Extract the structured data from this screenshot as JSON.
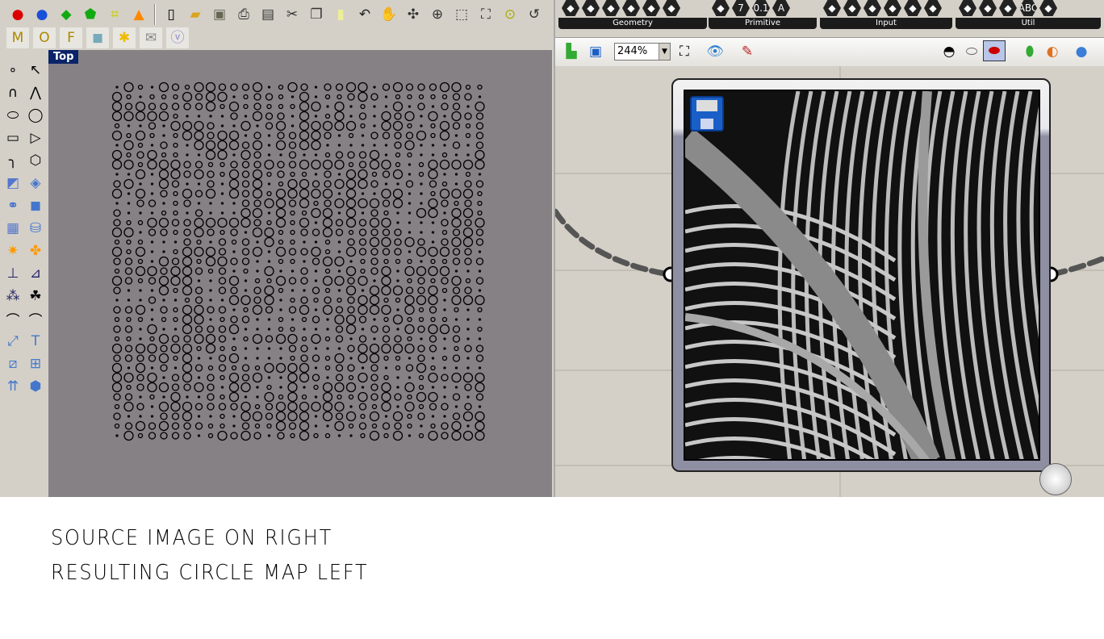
{
  "rhino": {
    "toolbar_main": [
      "sphere-red-icon",
      "sphere-blue-icon",
      "gem-green-icon",
      "shield-green-icon",
      "control-points-icon",
      "cone-orange-icon",
      "new-file-icon",
      "open-folder-icon",
      "save-icon",
      "print-icon",
      "import-icon",
      "cut-icon",
      "copy-icon",
      "paste-icon",
      "undo-icon",
      "pan-hand-icon",
      "rotate-view-icon",
      "zoom-icon",
      "zoom-window-icon",
      "zoom-extents-icon",
      "zoom-selected-icon",
      "undo-view-icon",
      "four-viewports-icon",
      "car-icon"
    ],
    "toolbar_osnap": [
      "tag-m-icon",
      "tag-o-icon",
      "tag-f-icon",
      "cube-icon",
      "asterisk-icon",
      "envelope-icon",
      "v-circle-icon"
    ],
    "viewport_label": "Top",
    "sidebar_left": [
      "point-icon",
      "curve-icon",
      "ellipse-icon",
      "rectangle-icon",
      "fillet-icon",
      "surface-icon",
      "boolean-icon",
      "mesh-surface-icon",
      "explode-icon",
      "dimension-icon",
      "group-icon",
      "blend-curve-icon",
      "scale-icon",
      "transform-icon",
      "extrude-icon"
    ],
    "sidebar_right": [
      "select-arrow-icon",
      "polyline-icon",
      "circle-icon",
      "polygon-arc-icon",
      "hexagon-icon",
      "patch-icon",
      "box-icon",
      "cylinder-icon",
      "puzzle-icon",
      "dimension-angle-icon",
      "shaded-group-icon",
      "arc-icon",
      "text-icon",
      "array-icon",
      "solid-icon"
    ]
  },
  "grasshopper": {
    "tab_groups": [
      {
        "label": "Geometry",
        "icons": [
          "x-icon",
          "arrow-icon",
          "circle-icon",
          "arc-icon",
          "spiral-icon",
          "line-icon"
        ]
      },
      {
        "label": "Primitive",
        "icons": [
          "drop-icon",
          "7",
          "0.1",
          "A"
        ]
      },
      {
        "label": "Input",
        "icons": [
          "import-icon",
          "graph-icon",
          "toggle-icon",
          "button-icon",
          "slider-icon",
          "list-icon"
        ]
      },
      {
        "label": "Util",
        "icons": [
          "tree-icon",
          "chart-icon",
          "gradient-icon",
          "ABC",
          "paint-icon"
        ]
      }
    ],
    "toolbar": {
      "zoom_value": "244%",
      "left_icons": [
        "open-icon",
        "save-icon"
      ],
      "right_icons": [
        "preview-icon",
        "wireframe-icon",
        "shaded-icon",
        "hide-icon",
        "material-icon",
        "sphere-icon"
      ]
    },
    "image_node_icon": "save-icon"
  },
  "caption": {
    "line1": "SOURCE IMAGE ON RIGHT",
    "line2": "RESULTING CIRCLE MAP LEFT"
  },
  "colors": {
    "viewport_bg": "#858185",
    "ui_bg": "#d4d0c8",
    "viewport_label_bg": "#0a2468"
  }
}
